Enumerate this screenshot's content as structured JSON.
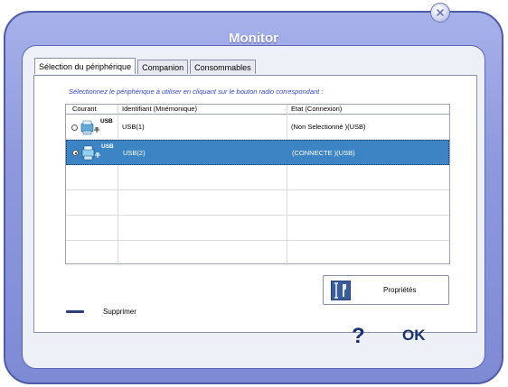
{
  "window": {
    "title": "Monitor"
  },
  "tabs": [
    {
      "label": "Sélection du périphérique",
      "active": true
    },
    {
      "label": "Companion",
      "active": false
    },
    {
      "label": "Consommables",
      "active": false
    }
  ],
  "instruction": "Sélectionnez le périphérique à utiliser en cliquant sur le bouton radio correspondant :",
  "table": {
    "columns": [
      "Courant",
      "Identifiant (Mnémonique)",
      "Etat (Connexion)"
    ],
    "rows": [
      {
        "selected": false,
        "icon": "usb-printer-icon",
        "icon_tag": "USB",
        "identifier": "USB(1)",
        "state": "(Non Selectionné )(USB)"
      },
      {
        "selected": true,
        "icon": "usb-printer-icon",
        "icon_tag": "USB",
        "identifier": "USB(2)",
        "state": "(CONNECTE )(USB)"
      }
    ]
  },
  "actions": {
    "delete_label": "Supprimer",
    "properties_label": "Propriétés",
    "help_label": "?",
    "ok_label": "OK"
  },
  "colors": {
    "frame": "#8e99dd",
    "selection": "#3c84c4",
    "instruction_text": "#3344cc",
    "button_text": "#1a2f74"
  }
}
